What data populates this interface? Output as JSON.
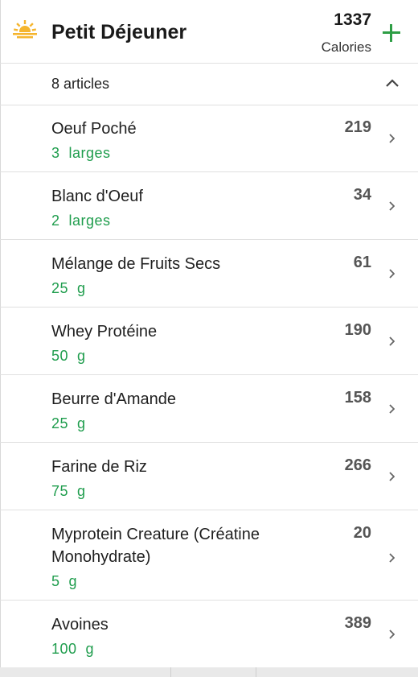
{
  "meal": {
    "title": "Petit Déjeuner",
    "total_calories": "1337",
    "calories_label": "Calories",
    "icon": "sunrise-icon",
    "add_icon": "plus-icon",
    "accent_color": "#2e9e45"
  },
  "summary": {
    "count_label": "8 articles",
    "collapse_icon": "chevron-up-icon"
  },
  "items": [
    {
      "name": "Oeuf Poché",
      "quantity": "3  larges",
      "calories": "219"
    },
    {
      "name": "Blanc d'Oeuf",
      "quantity": "2  larges",
      "calories": "34"
    },
    {
      "name": "Mélange de Fruits Secs",
      "quantity": "25  g",
      "calories": "61"
    },
    {
      "name": "Whey Protéine",
      "quantity": "50  g",
      "calories": "190"
    },
    {
      "name": "Beurre d'Amande",
      "quantity": "25  g",
      "calories": "158"
    },
    {
      "name": "Farine de Riz",
      "quantity": "75  g",
      "calories": "266"
    },
    {
      "name": "Myprotein Creature (Créatine Monohydrate)",
      "quantity": "5  g",
      "calories": "20"
    },
    {
      "name": "Avoines",
      "quantity": "100  g",
      "calories": "389"
    }
  ]
}
